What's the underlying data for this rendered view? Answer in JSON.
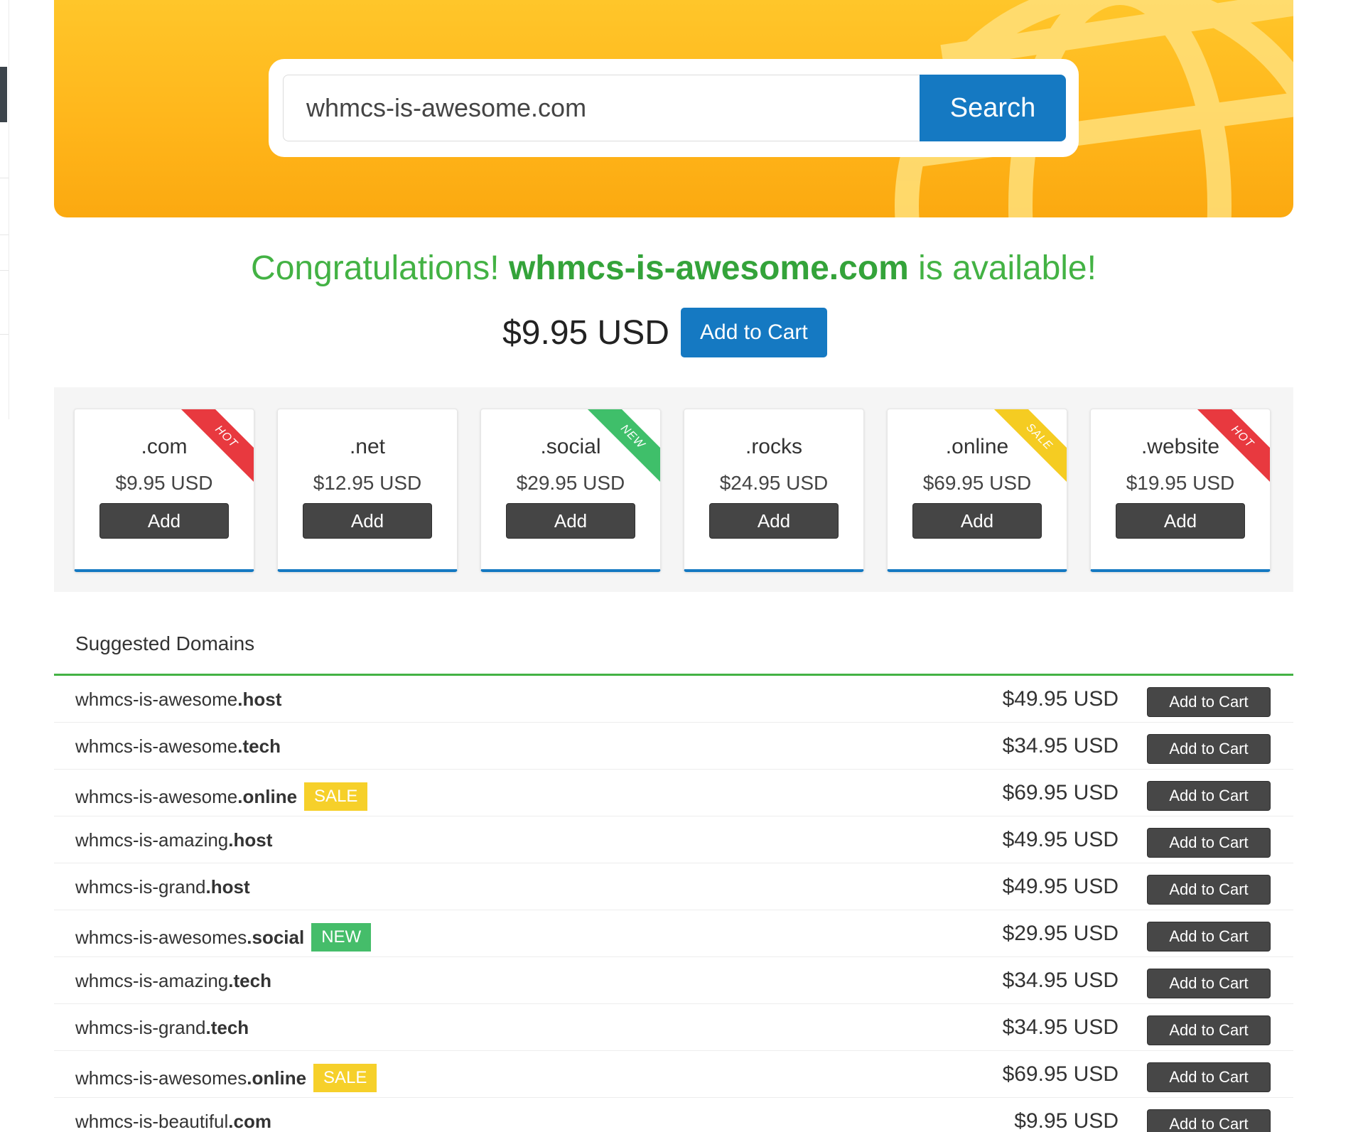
{
  "search": {
    "value": "whmcs-is-awesome.com",
    "button_label": "Search"
  },
  "result": {
    "prefix": "Congratulations! ",
    "domain": "whmcs-is-awesome.com",
    "suffix": " is available!",
    "price": "$9.95 USD",
    "add_label": "Add to Cart"
  },
  "tlds": [
    {
      "name": ".com",
      "price": "$9.95 USD",
      "add_label": "Add",
      "ribbon": "HOT"
    },
    {
      "name": ".net",
      "price": "$12.95 USD",
      "add_label": "Add",
      "ribbon": ""
    },
    {
      "name": ".social",
      "price": "$29.95 USD",
      "add_label": "Add",
      "ribbon": "NEW"
    },
    {
      "name": ".rocks",
      "price": "$24.95 USD",
      "add_label": "Add",
      "ribbon": ""
    },
    {
      "name": ".online",
      "price": "$69.95 USD",
      "add_label": "Add",
      "ribbon": "SALE"
    },
    {
      "name": ".website",
      "price": "$19.95 USD",
      "add_label": "Add",
      "ribbon": "HOT"
    }
  ],
  "colors": {
    "banner": "#ffb51a",
    "primary": "#1579c2",
    "success": "#43b244",
    "hot": "#e8393f",
    "new": "#3fbf6a",
    "sale": "#f5cc22"
  },
  "suggested": {
    "title": "Suggested Domains",
    "add_label": "Add to Cart",
    "rows": [
      {
        "sld": "whmcs-is-awesome",
        "tld": ".host",
        "badge": "",
        "price": "$49.95 USD"
      },
      {
        "sld": "whmcs-is-awesome",
        "tld": ".tech",
        "badge": "",
        "price": "$34.95 USD"
      },
      {
        "sld": "whmcs-is-awesome",
        "tld": ".online",
        "badge": "SALE",
        "price": "$69.95 USD"
      },
      {
        "sld": "whmcs-is-amazing",
        "tld": ".host",
        "badge": "",
        "price": "$49.95 USD"
      },
      {
        "sld": "whmcs-is-grand",
        "tld": ".host",
        "badge": "",
        "price": "$49.95 USD"
      },
      {
        "sld": "whmcs-is-awesomes",
        "tld": ".social",
        "badge": "NEW",
        "price": "$29.95 USD"
      },
      {
        "sld": "whmcs-is-amazing",
        "tld": ".tech",
        "badge": "",
        "price": "$34.95 USD"
      },
      {
        "sld": "whmcs-is-grand",
        "tld": ".tech",
        "badge": "",
        "price": "$34.95 USD"
      },
      {
        "sld": "whmcs-is-awesomes",
        "tld": ".online",
        "badge": "SALE",
        "price": "$69.95 USD"
      },
      {
        "sld": "whmcs-is-beautiful",
        "tld": ".com",
        "badge": "",
        "price": "$9.95 USD"
      }
    ]
  }
}
